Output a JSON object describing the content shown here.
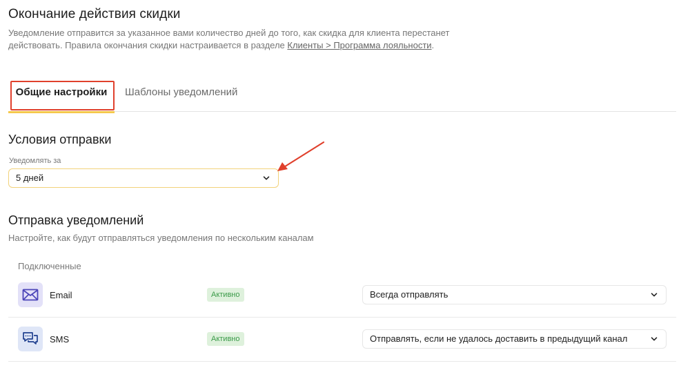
{
  "header": {
    "title": "Окончание действия скидки",
    "description_prefix": "Уведомление отправится за указанное вами количество дней до того, как скидка для клиента перестанет действовать. Правила окончания скидки настраивается в разделе ",
    "description_link": "Клиенты > Программа лояльности",
    "description_suffix": "."
  },
  "tabs": [
    {
      "label": "Общие настройки",
      "active": true
    },
    {
      "label": "Шаблоны уведомлений",
      "active": false
    }
  ],
  "conditions": {
    "title": "Условия отправки",
    "field_label": "Уведомлять за",
    "field_value": "5 дней"
  },
  "sending": {
    "title": "Отправка уведомлений",
    "description": "Настройте, как будут отправляться уведомления по нескольким каналам",
    "connected_label": "Подключенные",
    "channels": [
      {
        "name": "Email",
        "icon": "envelope-icon",
        "status": "Активно",
        "mode": "Всегда отправлять"
      },
      {
        "name": "SMS",
        "icon": "chat-bubbles-icon",
        "status": "Активно",
        "mode": "Отправлять, если не удалось доставить в предыдущий канал"
      }
    ]
  },
  "colors": {
    "accent": "#f5c84c",
    "highlight": "#e0402c",
    "badge_bg": "#def1dc",
    "badge_text": "#3a9a48"
  }
}
